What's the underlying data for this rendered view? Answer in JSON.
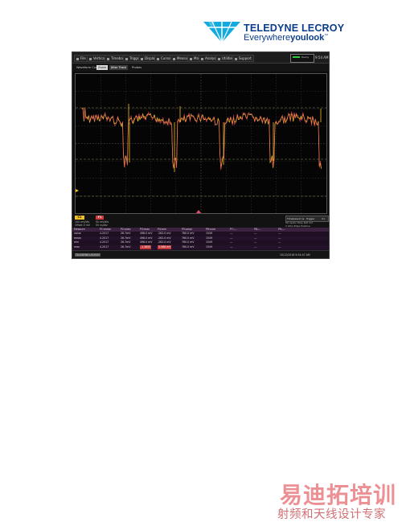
{
  "logo": {
    "brand": "TELEDYNE LECROY",
    "tagline_pre": "Everywhere",
    "tagline_bold": "youlook",
    "tagline_tm": "™"
  },
  "menu": [
    "File",
    "Vertical",
    "Timebase",
    "Trigger",
    "Display",
    "Cursors",
    "Measure",
    "Math",
    "Analysis",
    "Utilities",
    "Support"
  ],
  "status_box_text": "Ready",
  "clock": "9:54 AM",
  "tabs": [
    "Waveform Cursors",
    "Zoom",
    "Jitter Track",
    "Probes"
  ],
  "channel": {
    "badge": "C1",
    "line1": "100 mV/div",
    "line2": "Offset 0 mV",
    "fn_badge": "F1",
    "fn_line1": "50 mV/div",
    "fn_line2": "50 ns/div"
  },
  "timebase": {
    "box": [
      "Timebase",
      "0 ns",
      "Trigger",
      "C1"
    ],
    "line1": "50 ns/div  Stop  100 mV",
    "line2": "2 GS/s   Edge  Positive"
  },
  "table": {
    "headers": [
      "Measure",
      "P1:mean",
      "P2:sdev",
      "P3:max",
      "P4:min",
      "P5:ampl",
      "P6:num",
      "P7:---",
      "P8:---",
      "P9:---"
    ],
    "rows": [
      [
        "value",
        "4.2017",
        "26.7mV",
        "498.0 mV",
        "-262.0 mV",
        "760.0 mV",
        "1549",
        "---",
        "---",
        "---"
      ],
      [
        "mean",
        "4.2017",
        "26.7mV",
        "498.0 mV",
        "-262.0 mV",
        "760.0 mV",
        "1549",
        "---",
        "---",
        "---"
      ],
      [
        "min",
        "4.2017",
        "26.7mV",
        "498.0 mV",
        "-262.0 mV",
        "760.0 mV",
        "1549",
        "---",
        "---",
        "---"
      ],
      [
        "max",
        "4.2017",
        "26.7mV",
        "-1.3855",
        "3.568 mV",
        "760.0 mV",
        "1549",
        "---",
        "---",
        "---"
      ]
    ]
  },
  "footer": {
    "left": "TELEDYNE LECROY",
    "right": "10/12/2018 9:54:47 AM"
  },
  "watermark": {
    "main": "易迪拓培训",
    "sub": "射频和天线设计专家"
  },
  "colors": {
    "trace_primary": "#f0c020",
    "trace_secondary": "#e84a6a",
    "brand_blue": "#0a3c8c"
  }
}
